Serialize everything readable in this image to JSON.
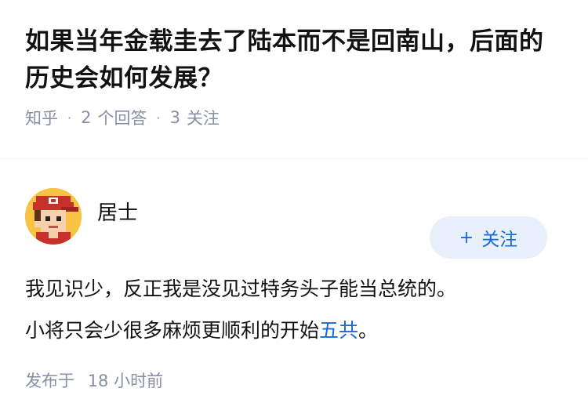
{
  "question": {
    "title": "如果当年金载圭去了陆本而不是回南山，后面的历史会如何发展？",
    "source": "知乎",
    "answer_count": "2",
    "answer_label": "个回答",
    "follow_count": "3",
    "follow_label": "关注"
  },
  "answer": {
    "author_name": "居士",
    "follow_button": "关注",
    "content_line1": "我见识少，反正我是没见过特务头子能当总统的。",
    "content_line2_prefix": "小将只会少很多麻烦更顺利的开始",
    "content_link": "五共",
    "content_line2_suffix": "。",
    "publish_label": "发布于",
    "publish_time": "18 小时前"
  },
  "colors": {
    "link": "#1769e0",
    "meta": "#8590a6",
    "follow_bg": "#e7f0fb"
  }
}
